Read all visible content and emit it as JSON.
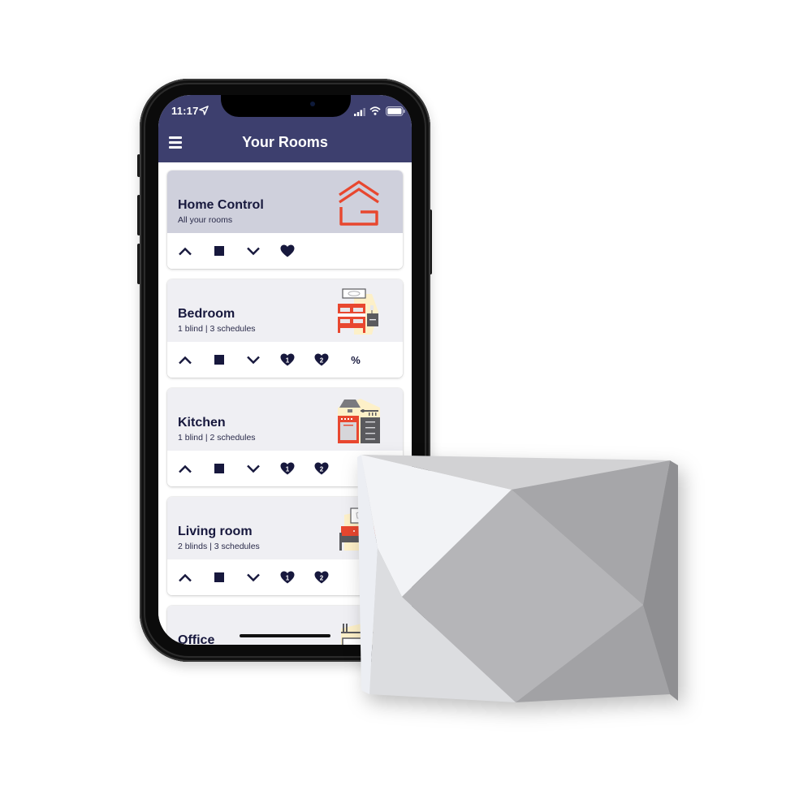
{
  "status_bar": {
    "time": "11:17",
    "icons": [
      "location-arrow-icon",
      "cellular-signal-icon",
      "wifi-icon",
      "battery-icon"
    ]
  },
  "header": {
    "title": "Your Rooms",
    "menu_icon": "hamburger-menu-icon"
  },
  "colors": {
    "header_bg": "#3d3f6e",
    "accent_red": "#e8472f",
    "icon_navy": "#17183d",
    "home_card_bg": "#cfd0dc",
    "card_head_bg": "#efeff3",
    "illustration_yellow": "#fdf0c8",
    "illustration_gray": "#5a5a5e"
  },
  "rooms": [
    {
      "name": "Home Control",
      "subtitle": "All your rooms",
      "art": "home-control-logo",
      "controls": [
        "open-up",
        "stop",
        "close-down",
        "favourite"
      ]
    },
    {
      "name": "Bedroom",
      "subtitle": "1 blind | 3 schedules",
      "art": "bedroom-illustration",
      "controls": [
        "open-up",
        "stop",
        "close-down",
        "favourite-1",
        "favourite-2",
        "percentage"
      ]
    },
    {
      "name": "Kitchen",
      "subtitle": "1 blind | 2 schedules",
      "art": "kitchen-illustration",
      "controls": [
        "open-up",
        "stop",
        "close-down",
        "favourite-1",
        "favourite-2"
      ]
    },
    {
      "name": "Living room",
      "subtitle": "2 blinds | 3 schedules",
      "art": "living-room-illustration",
      "controls": [
        "open-up",
        "stop",
        "close-down",
        "favourite-1",
        "favourite-2"
      ]
    },
    {
      "name": "Office",
      "subtitle": "",
      "art": "office-illustration",
      "controls": []
    }
  ],
  "control_labels": {
    "heart_1": "1",
    "heart_2": "2",
    "percent": "%"
  },
  "product": {
    "name": "geometric-hub-device"
  }
}
